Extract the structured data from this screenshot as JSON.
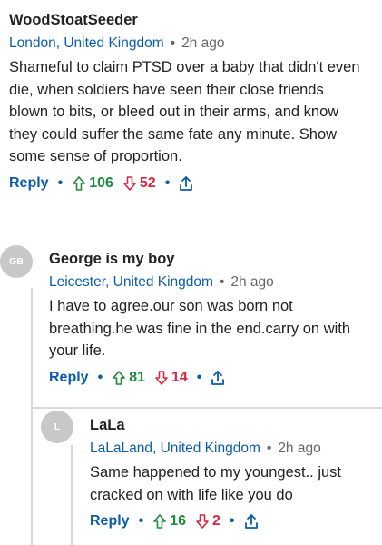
{
  "colors": {
    "link": "#0b5cab",
    "upvote": "#1d8a3c",
    "downvote": "#d7263d",
    "avatar": "#c8c8c8",
    "thread_line": "#d8d8d8"
  },
  "comments": [
    {
      "username": "WoodStoatSeeder",
      "location": "London, United Kingdom",
      "time": "2h ago",
      "body": "Shameful to claim PTSD over a baby that didn't even die, when soldiers have seen their close friends blown to bits, or bleed out in their arms, and know they could suffer the same fate any minute.  Show some sense of proportion.",
      "reply_label": "Reply",
      "upvotes": "106",
      "downvotes": "52",
      "icons": {
        "upvote": "arrow-up-icon",
        "downvote": "arrow-down-icon",
        "share": "share-icon"
      }
    },
    {
      "avatar_initials": "GB",
      "username": "George is my boy",
      "location": "Leicester, United Kingdom",
      "time": "2h ago",
      "body": "I have to agree.our son was born not breathing.he was fine in the end.carry on with your life.",
      "reply_label": "Reply",
      "upvotes": "81",
      "downvotes": "14",
      "icons": {
        "upvote": "arrow-up-icon",
        "downvote": "arrow-down-icon",
        "share": "share-icon"
      }
    },
    {
      "avatar_initials": "L",
      "username": "LaLa",
      "location": "LaLaLand, United Kingdom",
      "time": "2h ago",
      "body": "Same happened to my youngest.. just cracked on with life like you do",
      "reply_label": "Reply",
      "upvotes": "16",
      "downvotes": "2",
      "icons": {
        "upvote": "arrow-up-icon",
        "downvote": "arrow-down-icon",
        "share": "share-icon"
      }
    }
  ]
}
